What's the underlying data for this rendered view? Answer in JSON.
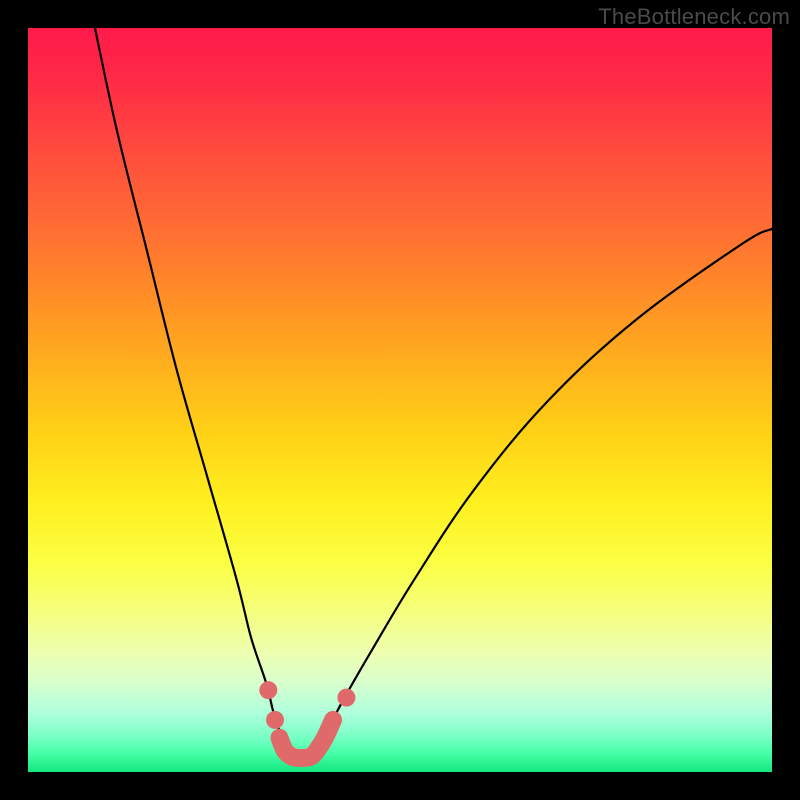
{
  "attribution": "TheBottleneck.com",
  "chart_data": {
    "type": "line",
    "title": "",
    "xlabel": "",
    "ylabel": "",
    "xlim": [
      0,
      100
    ],
    "ylim": [
      0,
      100
    ],
    "grid": false,
    "series": [
      {
        "name": "bottleneck-curve",
        "x": [
          9,
          12,
          16,
          20,
          24,
          28,
          30,
          32,
          33,
          34,
          35,
          36,
          37,
          38,
          39,
          40,
          42,
          46,
          52,
          60,
          70,
          82,
          96,
          100
        ],
        "y": [
          100,
          86,
          70,
          54,
          40,
          26,
          18,
          12,
          8,
          5,
          3,
          2,
          2,
          2,
          3,
          5,
          9,
          16,
          26,
          38,
          50,
          61,
          71,
          73
        ]
      }
    ],
    "markers": [
      {
        "name": "marker-left-upper",
        "x": 32.3,
        "y": 11.0
      },
      {
        "name": "marker-left-lower",
        "x": 33.2,
        "y": 7.0
      },
      {
        "name": "marker-right-upper",
        "x": 42.8,
        "y": 10.0
      }
    ],
    "trough_segment": {
      "x": [
        33.8,
        34.5,
        35.4,
        36.3,
        37.2,
        38.1,
        38.9,
        39.9,
        41.0
      ],
      "y": [
        4.6,
        2.9,
        2.1,
        1.9,
        1.9,
        2.1,
        3.0,
        4.6,
        7.0
      ]
    },
    "marker_color": "#e06a6a",
    "curve_color": "#000000"
  }
}
